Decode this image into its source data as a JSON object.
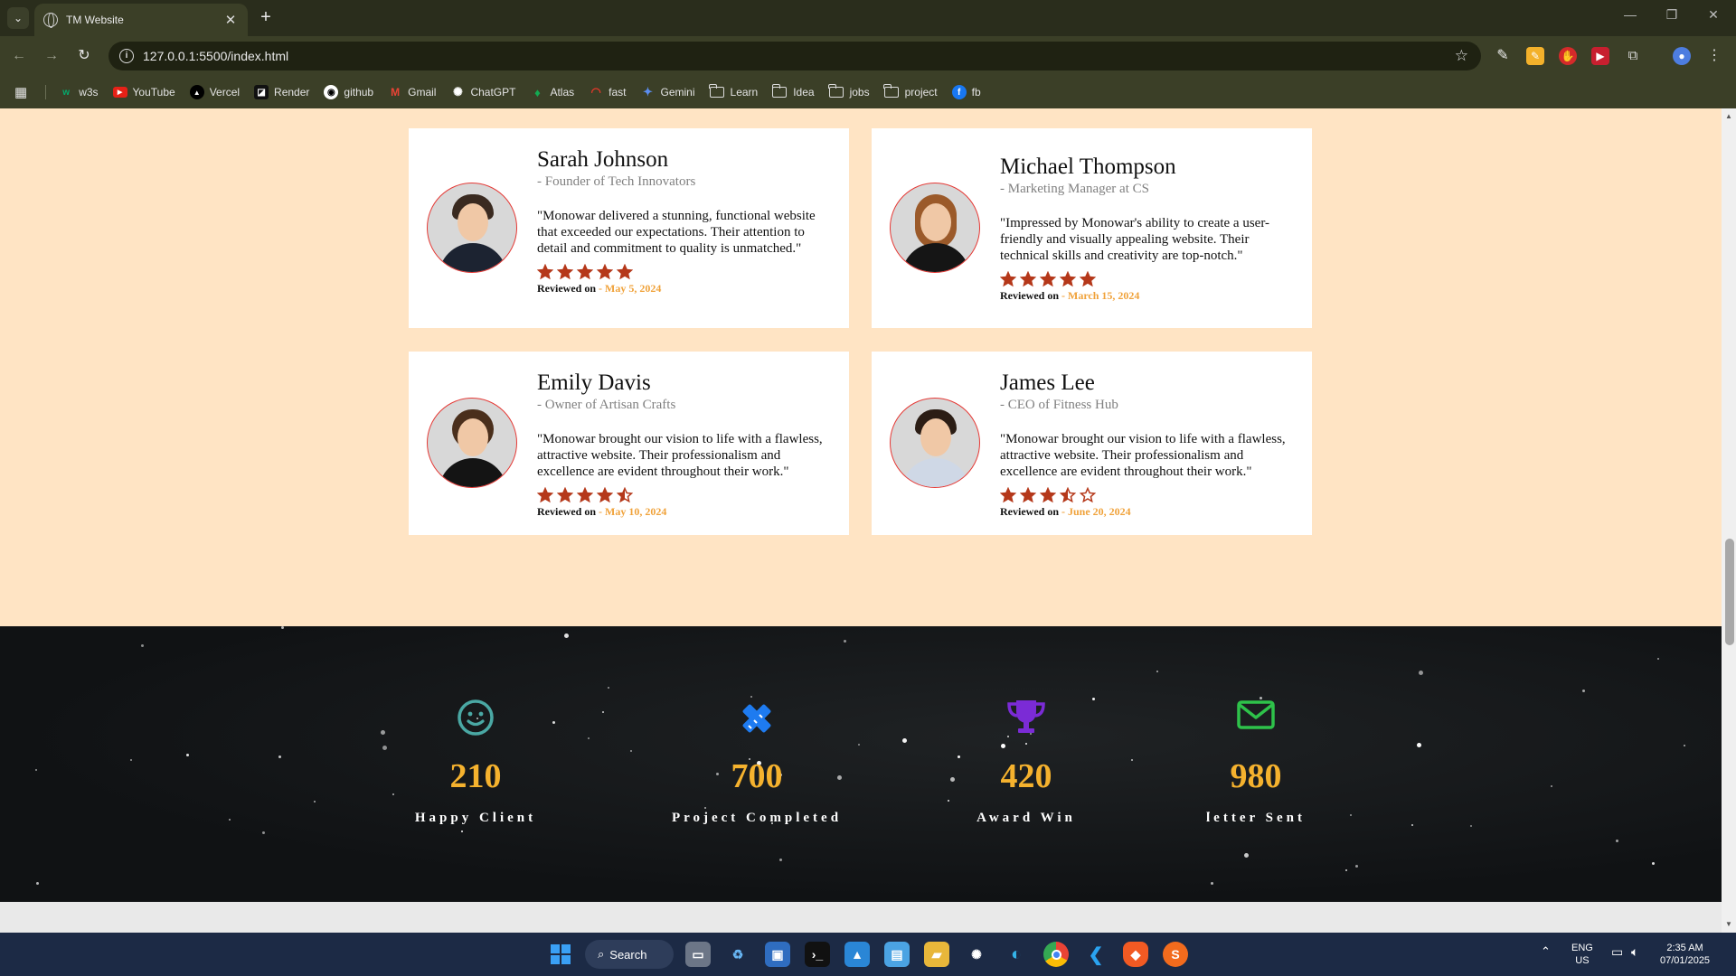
{
  "browser": {
    "tab_title": "TM Website",
    "url": "127.0.0.1:5500/index.html",
    "bookmarks": [
      "w3s",
      "YouTube",
      "Vercel",
      "Render",
      "github",
      "Gmail",
      "ChatGPT",
      "Atlas",
      "fast",
      "Gemini",
      "Learn",
      "Idea",
      "jobs",
      "project",
      "fb"
    ]
  },
  "testimonials": [
    {
      "name": "Sarah Johnson",
      "role": "- Founder of Tech Innovators",
      "quote": "\"Monowar delivered a stunning, functional website that exceeded our expectations. Their attention to detail and commitment to quality is unmatched.\"",
      "rating": 5,
      "reviewed_label": "Reviewed on",
      "date": "- May 5, 2024"
    },
    {
      "name": "Michael Thompson",
      "role": "- Marketing Manager at CS",
      "quote": "\"Impressed by Monowar's ability to create a user-friendly and visually appealing website. Their technical skills and creativity are top-notch.\"",
      "rating": 5,
      "reviewed_label": "Reviewed on",
      "date": "- March 15, 2024"
    },
    {
      "name": "Emily Davis",
      "role": "- Owner of Artisan Crafts",
      "quote": "\"Monowar brought our vision to life with a flawless, attractive website. Their professionalism and excellence are evident throughout their work.\"",
      "rating": 4.5,
      "reviewed_label": "Reviewed on",
      "date": "- May 10, 2024"
    },
    {
      "name": "James Lee",
      "role": "- CEO of Fitness Hub",
      "quote": "\"Monowar brought our vision to life with a flawless, attractive website. Their professionalism and excellence are evident throughout their work.\"",
      "rating": 3.5,
      "reviewed_label": "Reviewed on",
      "date": "- June 20, 2024"
    }
  ],
  "stats": [
    {
      "icon": "smile-icon",
      "value": "210",
      "label": "Happy Client",
      "color": "#4aa8a4"
    },
    {
      "icon": "pencil-ruler-icon",
      "value": "700",
      "label": "Project Completed",
      "color": "#1e7bf0"
    },
    {
      "icon": "trophy-icon",
      "value": "420",
      "label": "Award Win",
      "color": "#7b2bd6"
    },
    {
      "icon": "envelope-icon",
      "value": "980",
      "label": "letter Sent",
      "color": "#2ec24a"
    }
  ],
  "colors": {
    "page_bg": "#ffe4c4",
    "star": "#b5381a",
    "date": "#f0a23a",
    "stat_number": "#f5b22e",
    "avatar_border": "#e53935"
  },
  "taskbar": {
    "search_label": "Search",
    "lang_top": "ENG",
    "lang_bottom": "US",
    "time": "2:35 AM",
    "date": "07/01/2025"
  }
}
